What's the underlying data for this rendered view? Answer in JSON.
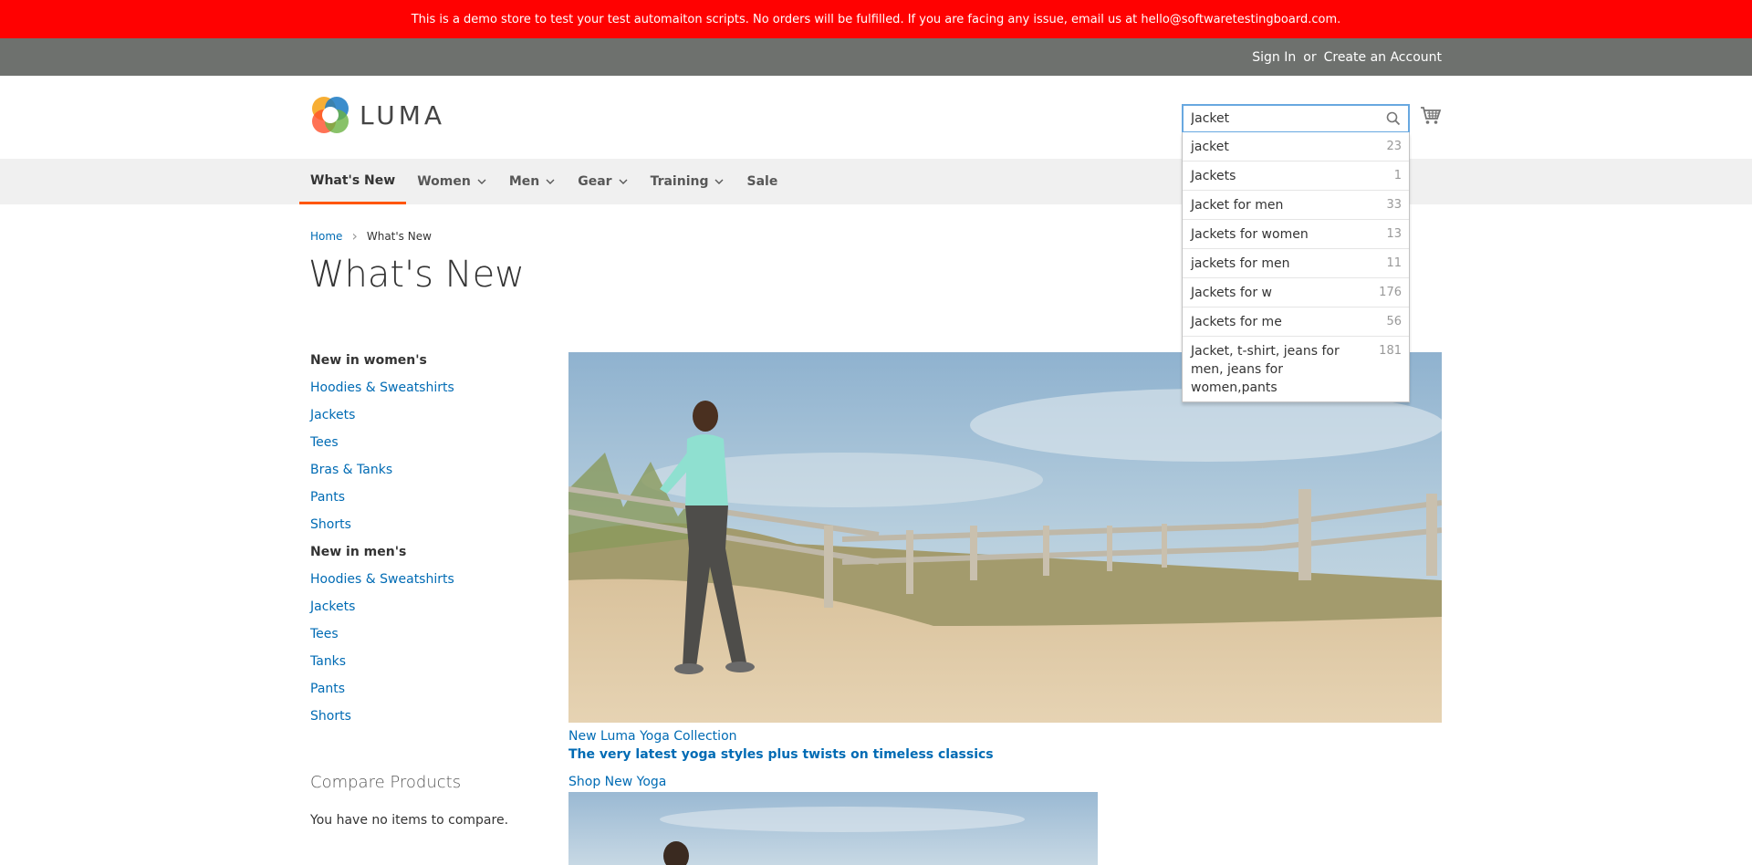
{
  "notice": {
    "text": "This is a demo store to test your test automaiton scripts. No orders will be fulfilled. If you are facing any issue, email us at hello@softwaretestingboard.com."
  },
  "header": {
    "sign_in": "Sign In",
    "or": "or",
    "create_account": "Create an Account"
  },
  "logo": {
    "text": "LUMA"
  },
  "search": {
    "value": "Jacket"
  },
  "nav": [
    {
      "label": "What's New",
      "dropdown": false,
      "active": true
    },
    {
      "label": "Women",
      "dropdown": true
    },
    {
      "label": "Men",
      "dropdown": true
    },
    {
      "label": "Gear",
      "dropdown": true
    },
    {
      "label": "Training",
      "dropdown": true
    },
    {
      "label": "Sale",
      "dropdown": false
    }
  ],
  "breadcrumbs": {
    "home": "Home",
    "separator": "›",
    "current": "What's New"
  },
  "page": {
    "title": "What's New"
  },
  "sidebar": {
    "women_heading": "New in women's",
    "women_links": [
      "Hoodies & Sweatshirts",
      "Jackets",
      "Tees",
      "Bras & Tanks",
      "Pants",
      "Shorts"
    ],
    "men_heading": "New in men's",
    "men_links": [
      "Hoodies & Sweatshirts",
      "Jackets",
      "Tees",
      "Tanks",
      "Pants",
      "Shorts"
    ]
  },
  "compare": {
    "title": "Compare Products",
    "empty": "You have no items to compare."
  },
  "promo": {
    "line1": "New Luma Yoga Collection",
    "line2": "The very latest yoga styles plus twists on timeless classics",
    "line3": "Shop New Yoga"
  },
  "autocomplete": [
    {
      "term": "jacket",
      "count": "23"
    },
    {
      "term": "Jackets",
      "count": "1"
    },
    {
      "term": "Jacket for men",
      "count": "33"
    },
    {
      "term": "Jackets for women",
      "count": "13"
    },
    {
      "term": "jackets for men",
      "count": "11"
    },
    {
      "term": "Jackets for w",
      "count": "176"
    },
    {
      "term": "Jackets for me",
      "count": "56"
    },
    {
      "term": "Jacket, t-shirt, jeans for men, jeans for women,pants",
      "count": "181"
    }
  ],
  "colors": {
    "notice": "#ff0101",
    "panel": "#6e716e",
    "link": "#006bb4",
    "nav_active": "#ff5501",
    "search_border": "#68a8e0"
  }
}
